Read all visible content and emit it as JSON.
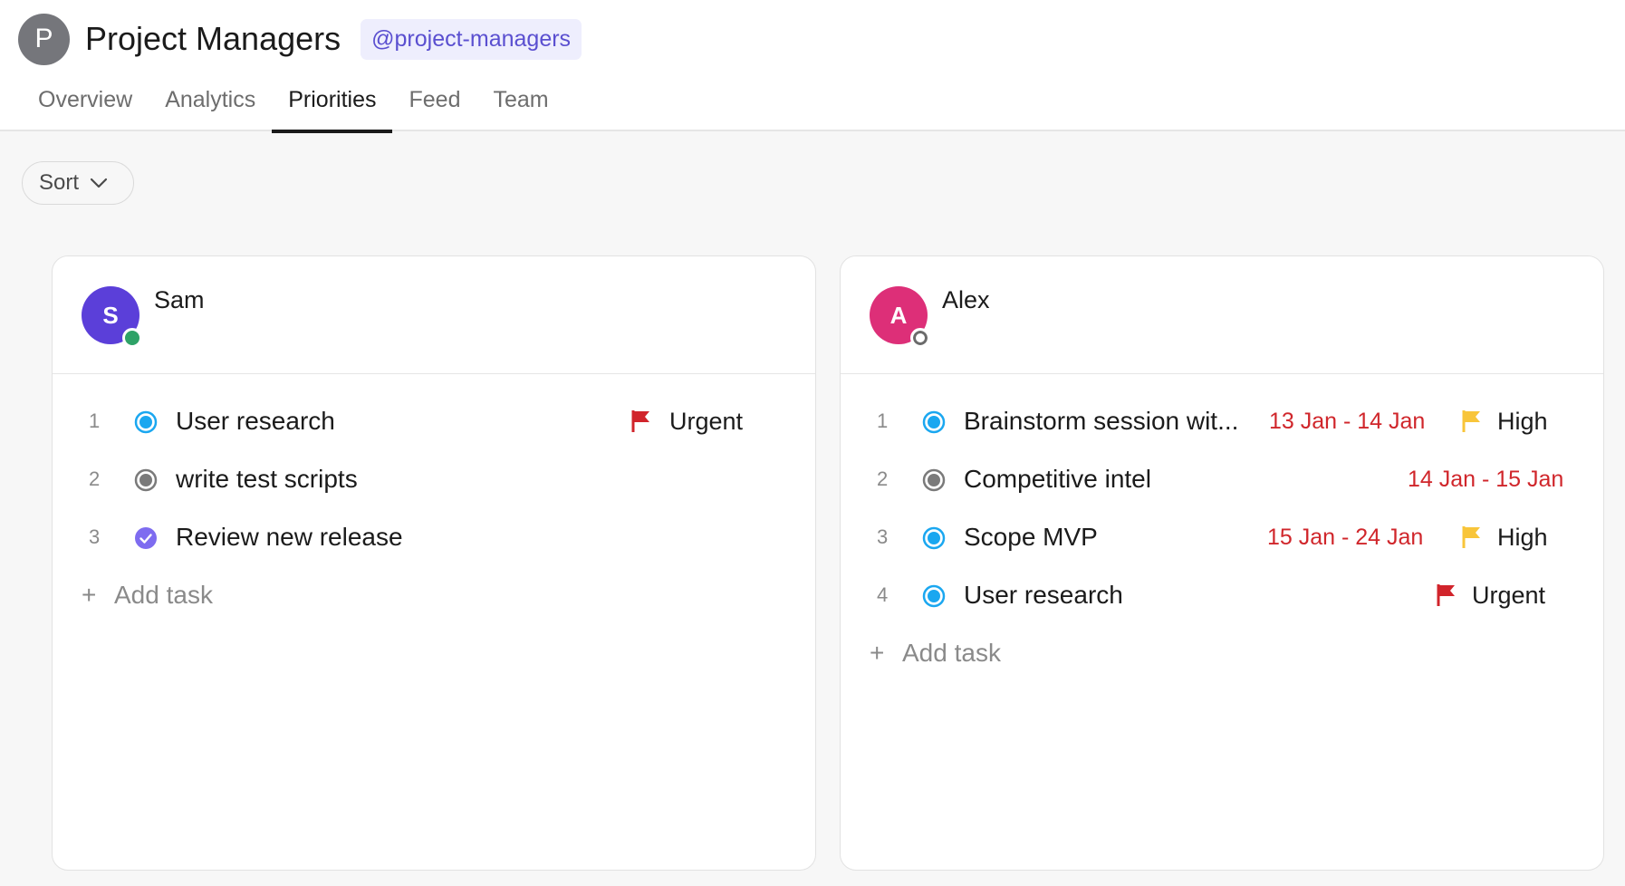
{
  "team": {
    "avatar_letter": "P",
    "name": "Project Managers",
    "handle": "@project-managers"
  },
  "tabs": [
    {
      "label": "Overview",
      "active": false
    },
    {
      "label": "Analytics",
      "active": false
    },
    {
      "label": "Priorities",
      "active": true
    },
    {
      "label": "Feed",
      "active": false
    },
    {
      "label": "Team",
      "active": false
    }
  ],
  "sort": {
    "label": "Sort"
  },
  "members": [
    {
      "name": "Sam",
      "initial": "S",
      "avatar_color": "#5b3fd9",
      "presence": "online",
      "add_task_label": "Add task",
      "tasks": [
        {
          "num": "1",
          "title": "User research",
          "status": "in-progress",
          "dates": "",
          "priority": "Urgent",
          "flag": "red-flag-icon"
        },
        {
          "num": "2",
          "title": "write test scripts",
          "status": "todo",
          "dates": "",
          "priority": "",
          "flag": ""
        },
        {
          "num": "3",
          "title": "Review new release",
          "status": "done",
          "dates": "",
          "priority": "",
          "flag": ""
        }
      ]
    },
    {
      "name": "Alex",
      "initial": "A",
      "avatar_color": "#dd2f78",
      "presence": "offline",
      "add_task_label": "Add task",
      "tasks": [
        {
          "num": "1",
          "title": "Brainstorm session wit...",
          "status": "in-progress",
          "dates": "13 Jan - 14 Jan",
          "priority": "High",
          "flag": "yellow-flag-icon"
        },
        {
          "num": "2",
          "title": "Competitive intel",
          "status": "todo",
          "dates": "14 Jan - 15 Jan",
          "priority": "",
          "flag": ""
        },
        {
          "num": "3",
          "title": "Scope MVP",
          "status": "in-progress",
          "dates": "15 Jan - 24 Jan",
          "priority": "High",
          "flag": "yellow-flag-icon"
        },
        {
          "num": "4",
          "title": "User research",
          "status": "in-progress",
          "dates": "",
          "priority": "Urgent",
          "flag": "red-flag-icon"
        }
      ]
    }
  ],
  "colors": {
    "in_progress": "#1aa7f0",
    "todo": "#7a7a7a",
    "done": "#7e6cf0",
    "urgent_flag": "#d1242b",
    "high_flag": "#f8c53a",
    "date_text": "#d0262b"
  }
}
